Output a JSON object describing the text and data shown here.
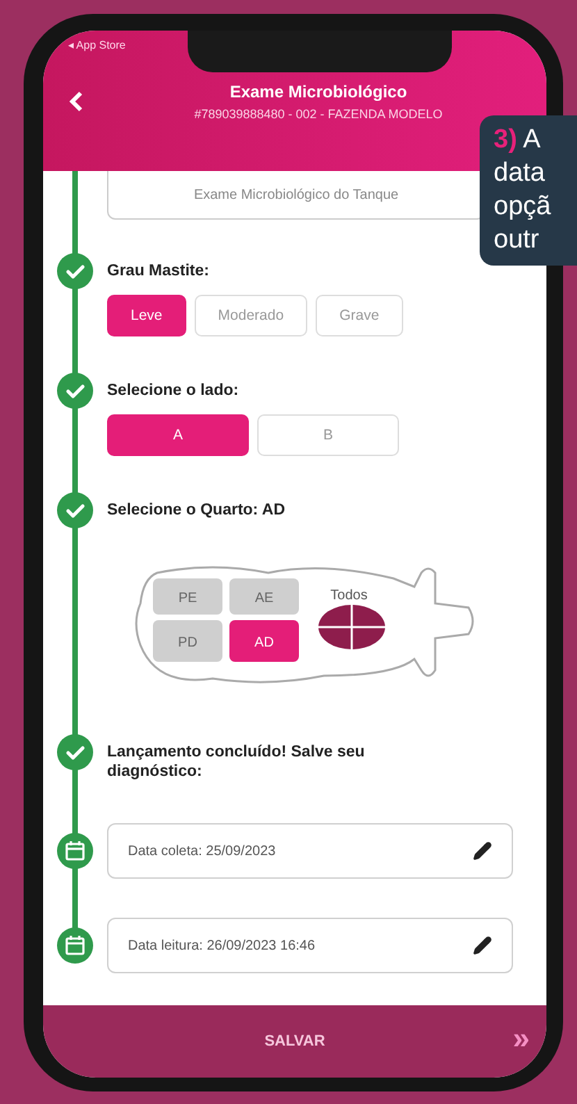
{
  "status_bar": {
    "back_label": "◂ App Store"
  },
  "header": {
    "title": "Exame Microbiológico",
    "subtitle": "#789039888480 - 002 - FAZENDA MODELO"
  },
  "steps": [
    {
      "kind": "field",
      "value": "Exame Microbiológico do Tanque"
    },
    {
      "kind": "choice",
      "label": "Grau Mastite:",
      "options": [
        {
          "label": "Leve",
          "selected": true
        },
        {
          "label": "Moderado",
          "selected": false
        },
        {
          "label": "Grave",
          "selected": false
        }
      ]
    },
    {
      "kind": "choice",
      "label": "Selecione o lado:",
      "options": [
        {
          "label": "A",
          "selected": true
        },
        {
          "label": "B",
          "selected": false
        }
      ]
    },
    {
      "kind": "udder",
      "label": "Selecione o Quarto: AD",
      "quarters": [
        {
          "label": "PE",
          "selected": false
        },
        {
          "label": "AE",
          "selected": false
        },
        {
          "label": "PD",
          "selected": false
        },
        {
          "label": "AD",
          "selected": true
        }
      ],
      "all_label": "Todos"
    },
    {
      "kind": "note",
      "label": "Lançamento concluído! Salve seu diagnóstico:"
    },
    {
      "kind": "date",
      "value": "Data coleta: 25/09/2023"
    },
    {
      "kind": "date",
      "value": "Data leitura: 26/09/2023 16:46"
    }
  ],
  "footer": {
    "button": "SALVAR",
    "next": "»"
  },
  "callout": {
    "number": "3)",
    "lines": [
      "A",
      "data",
      "opçã",
      "outr"
    ]
  }
}
